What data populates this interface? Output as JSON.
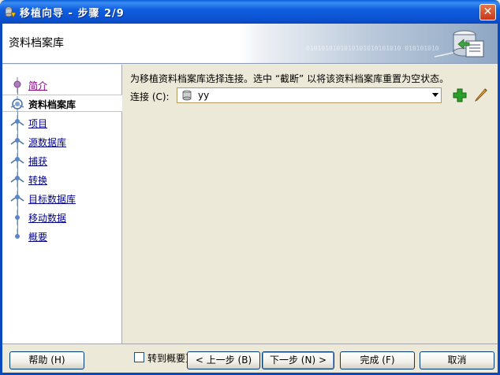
{
  "window": {
    "title": "移植向导 - 步骤 2/9",
    "close_symbol": "✕"
  },
  "banner": {
    "title": "资料档案库",
    "binary_text": "0101010101010101010101010   010101010"
  },
  "nav": {
    "items": [
      {
        "label": "简介",
        "state": "visited"
      },
      {
        "label": "资料档案库",
        "state": "current"
      },
      {
        "label": "项目",
        "state": "link"
      },
      {
        "label": "源数据库",
        "state": "link"
      },
      {
        "label": "捕获",
        "state": "link"
      },
      {
        "label": "转换",
        "state": "link"
      },
      {
        "label": "目标数据库",
        "state": "link"
      },
      {
        "label": "移动数据",
        "state": "link"
      },
      {
        "label": "概要",
        "state": "link"
      }
    ]
  },
  "content": {
    "description": "为移植资料档案库选择连接。选中 “截断” 以将该资料档案库重置为空状态。",
    "connection_label": "连接 (C):",
    "connection_value": "yy",
    "summary_checkbox_label": "转到概要页"
  },
  "footer": {
    "help": "帮助 (H)",
    "back": "< 上一步 (B)",
    "next": "下一步 (N) >",
    "finish": "完成 (F)",
    "cancel": "取消"
  },
  "colors": {
    "title_blue": "#0a5fd8",
    "add_green": "#2aa02a",
    "edit_orange": "#e8a33c"
  }
}
